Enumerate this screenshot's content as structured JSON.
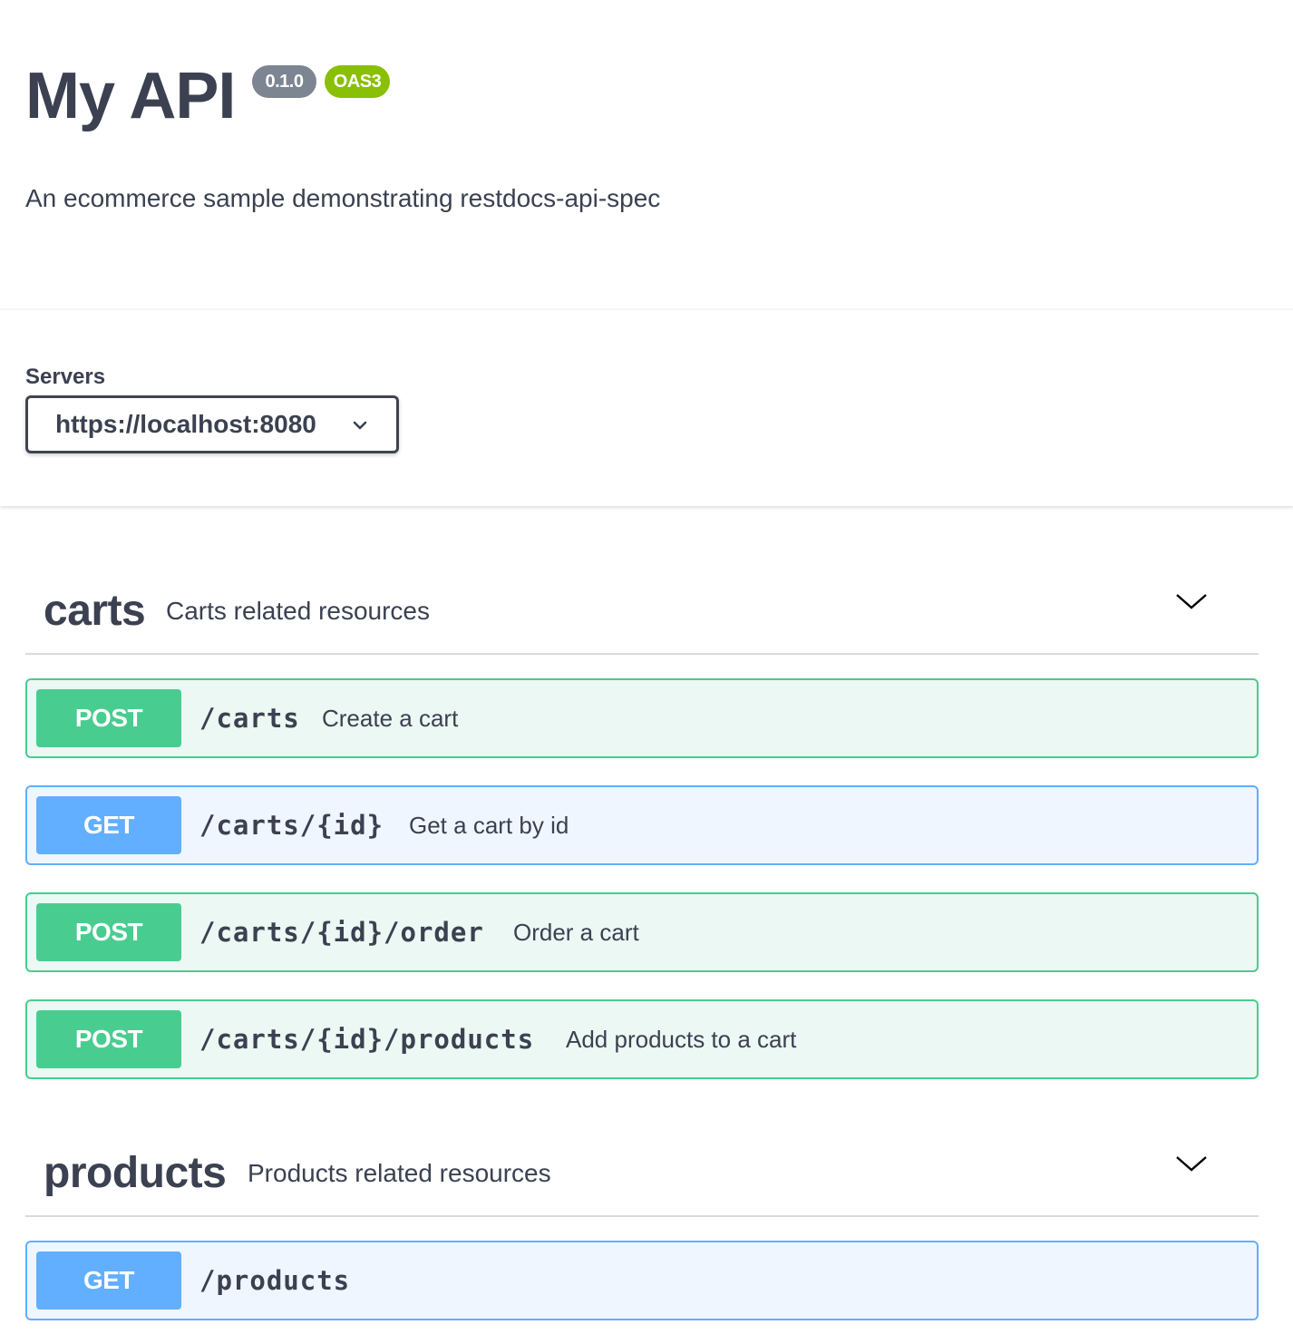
{
  "info": {
    "title": "My API",
    "version": "0.1.0",
    "spec_badge": "OAS3",
    "description": "An ecommerce sample demonstrating restdocs-api-spec"
  },
  "servers": {
    "label": "Servers",
    "selected": "https://localhost:8080"
  },
  "tags": [
    {
      "name": "carts",
      "description": "Carts related resources",
      "operations": [
        {
          "method": "POST",
          "path": "/carts",
          "summary": "Create a cart"
        },
        {
          "method": "GET",
          "path": "/carts/{id}",
          "summary": "Get a cart by id"
        },
        {
          "method": "POST",
          "path": "/carts/{id}/order",
          "summary": "Order a cart"
        },
        {
          "method": "POST",
          "path": "/carts/{id}/products",
          "summary": "Add products to a cart"
        }
      ]
    },
    {
      "name": "products",
      "description": "Products related resources",
      "operations": [
        {
          "method": "GET",
          "path": "/products",
          "summary": ""
        }
      ]
    }
  ],
  "colors": {
    "post": "#49cc90",
    "get": "#61affe",
    "version_badge": "#7d8492",
    "oas_badge": "#89bf04",
    "text": "#3b4151"
  },
  "icons": {
    "server_dropdown": "chevron-down-icon",
    "tag_toggle": "chevron-down-icon"
  }
}
